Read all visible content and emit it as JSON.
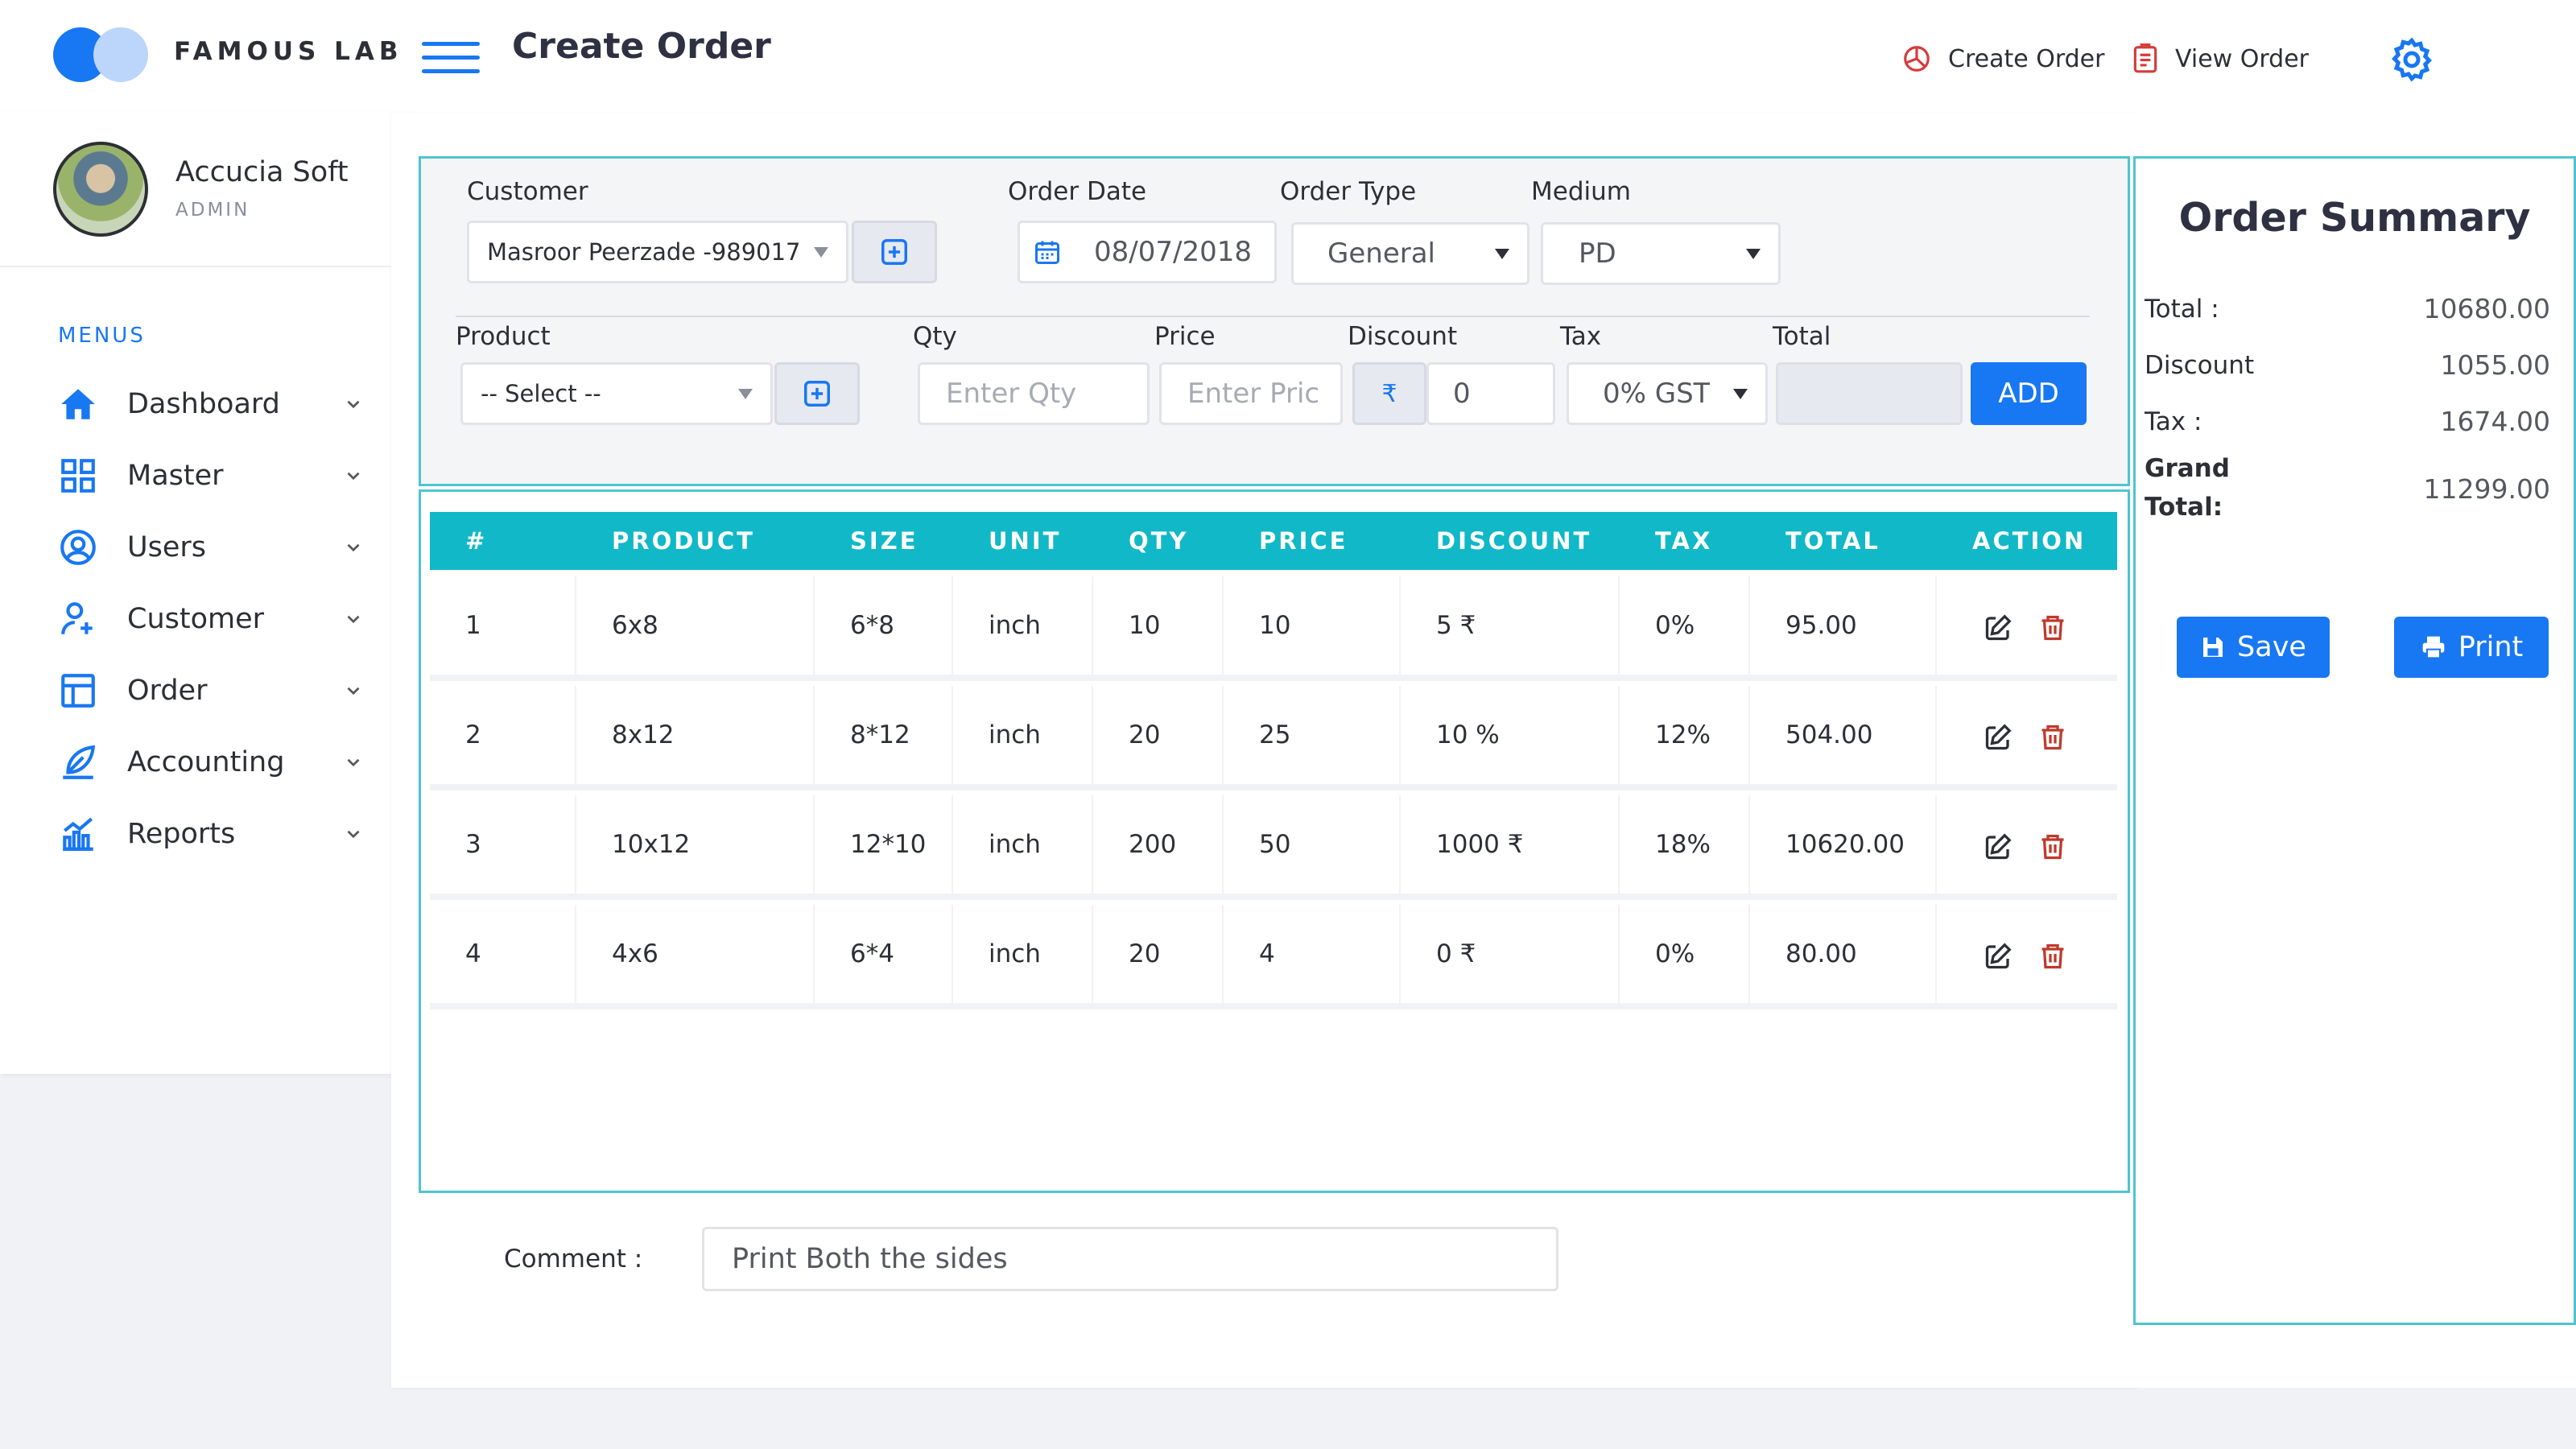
{
  "app": {
    "brand": "FAMOUS LAB",
    "page_title": "Create Order"
  },
  "header": {
    "links": [
      {
        "label": "Create Order",
        "icon": "pie-chart-icon"
      },
      {
        "label": "View Order",
        "icon": "clipboard-list-icon"
      }
    ],
    "settings_icon": "gear-icon"
  },
  "user": {
    "name": "Accucia Soft",
    "role": "ADMIN"
  },
  "sidebar": {
    "section_label": "MENUS",
    "items": [
      {
        "label": "Dashboard",
        "icon": "home-icon"
      },
      {
        "label": "Master",
        "icon": "grid-icon"
      },
      {
        "label": "Users",
        "icon": "user-circle-icon"
      },
      {
        "label": "Customer",
        "icon": "user-plus-icon"
      },
      {
        "label": "Order",
        "icon": "layout-icon"
      },
      {
        "label": "Accounting",
        "icon": "feather-icon"
      },
      {
        "label": "Reports",
        "icon": "bar-chart-icon"
      }
    ]
  },
  "form": {
    "customer_label": "Customer",
    "customer_value": "Masroor Peerzade -989017...",
    "order_date_label": "Order Date",
    "order_date_value": "08/07/2018",
    "order_type_label": "Order Type",
    "order_type_value": "General",
    "medium_label": "Medium",
    "medium_value": "PD",
    "product_label": "Product",
    "product_value": "-- Select --",
    "qty_label": "Qty",
    "qty_placeholder": "Enter Qty",
    "price_label": "Price",
    "price_placeholder": "Enter Pric",
    "discount_label": "Discount",
    "discount_symbol": "₹",
    "discount_value": "0",
    "tax_label": "Tax",
    "tax_value": "0% GST",
    "total_label": "Total",
    "total_value": "",
    "add_label": "ADD"
  },
  "table": {
    "columns": [
      "#",
      "PRODUCT",
      "SIZE",
      "UNIT",
      "QTY",
      "PRICE",
      "DISCOUNT",
      "TAX",
      "TOTAL",
      "ACTION"
    ],
    "rows": [
      {
        "no": "1",
        "product": "6x8",
        "size": "6*8",
        "unit": "inch",
        "qty": "10",
        "price": "10",
        "discount": "5 ₹",
        "tax": "0%",
        "total": "95.00"
      },
      {
        "no": "2",
        "product": "8x12",
        "size": "8*12",
        "unit": "inch",
        "qty": "20",
        "price": "25",
        "discount": "10 %",
        "tax": "12%",
        "total": "504.00"
      },
      {
        "no": "3",
        "product": "10x12",
        "size": "12*10",
        "unit": "inch",
        "qty": "200",
        "price": "50",
        "discount": "1000 ₹",
        "tax": "18%",
        "total": "10620.00"
      },
      {
        "no": "4",
        "product": "4x6",
        "size": "6*4",
        "unit": "inch",
        "qty": "20",
        "price": "4",
        "discount": "0 ₹",
        "tax": "0%",
        "total": "80.00"
      }
    ]
  },
  "comment": {
    "label": "Comment :",
    "value": "Print Both the sides"
  },
  "summary": {
    "title": "Order Summary",
    "total_label": "Total :",
    "total_value": "10680.00",
    "discount_label": "Discount",
    "discount_value": "1055.00",
    "tax_label": "Tax :",
    "tax_value": "1674.00",
    "grand_label_1": "Grand",
    "grand_label_2": "Total:",
    "grand_value": "11299.00",
    "save_label": "Save",
    "print_label": "Print"
  },
  "colors": {
    "primary": "#1877f2",
    "teal": "#11b8c7",
    "panel_border": "#4fc4cf",
    "danger": "#c0392b"
  }
}
